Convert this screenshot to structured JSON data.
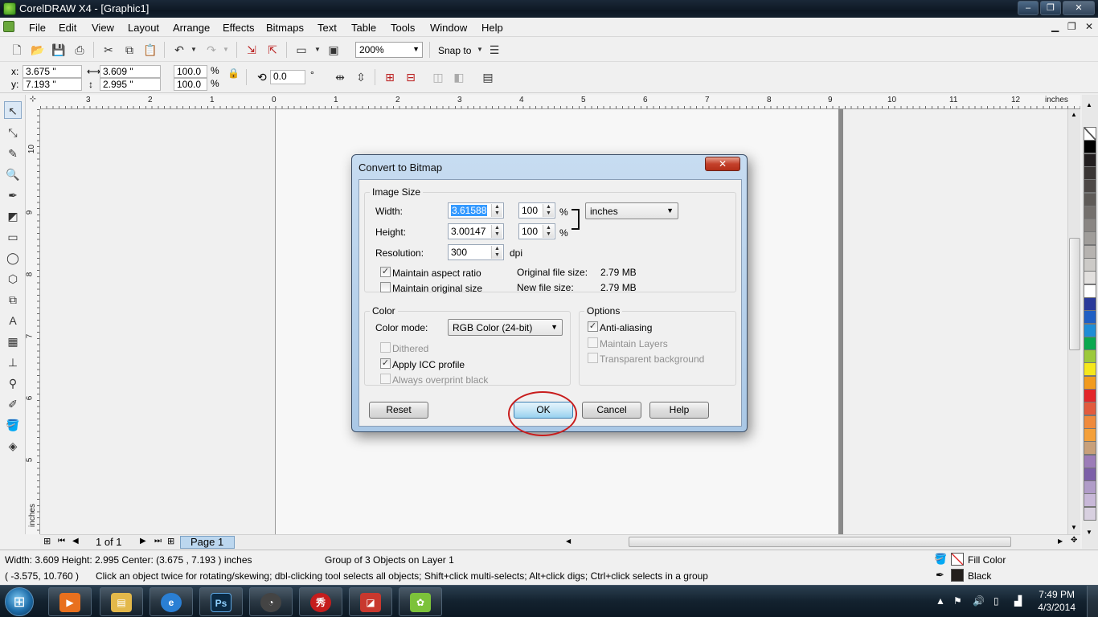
{
  "window": {
    "title": "CorelDRAW X4 - [Graphic1]",
    "minimize": "‒",
    "maximize": "❐",
    "close": "✕"
  },
  "menu": [
    "File",
    "Edit",
    "View",
    "Layout",
    "Arrange",
    "Effects",
    "Bitmaps",
    "Text",
    "Table",
    "Tools",
    "Window",
    "Help"
  ],
  "toolbar": {
    "zoom": "200%",
    "snap_to": "Snap to"
  },
  "property_bar": {
    "x_label": "x:",
    "x": "3.675 \"",
    "y_label": "y:",
    "y": "7.193 \"",
    "width": "3.609 \"",
    "height": "2.995 \"",
    "scale_x": "100.0",
    "scale_y": "100.0",
    "percent": "%",
    "rotation": "0.0",
    "degree": "°"
  },
  "ruler": {
    "units": "inches",
    "h_labels": [
      "3",
      "2",
      "1",
      "0",
      "1",
      "2",
      "3",
      "4",
      "5",
      "6",
      "7",
      "8",
      "9",
      "10",
      "11",
      "12"
    ],
    "v_labels": [
      "10",
      "9",
      "8",
      "7",
      "6",
      "5"
    ],
    "v_units": "inches"
  },
  "page_nav": {
    "position": "1 of 1",
    "tab": "Page 1"
  },
  "palette_colors": [
    "#ffffff",
    "#000000",
    "#231f20",
    "#3a3635",
    "#4d4846",
    "#5f5b58",
    "#74706d",
    "#8a8683",
    "#a09d9a",
    "#b6b3b0",
    "#cccac7",
    "#e2e0de",
    "#ffffff",
    "#2a3a9a",
    "#1f5fc4",
    "#1e8dd6",
    "#0aa84f",
    "#9cc93b",
    "#f5e71c",
    "#f29b1e",
    "#e3262a",
    "#e25a3d",
    "#ef8a3c",
    "#f4a03a",
    "#c8a07a",
    "#9c7cb8",
    "#7c5fa8",
    "#b09cc8",
    "#c8b8d8",
    "#d8d0e0"
  ],
  "status": {
    "dimensions": "Width: 3.609  Height: 2.995  Center: (3.675 , 7.193 )  inches",
    "object_info": "Group of 3 Objects on Layer 1",
    "cursor": "( -3.575, 10.760 )",
    "hint": "Click an object twice for rotating/skewing; dbl-clicking tool selects all objects; Shift+click multi-selects; Alt+click digs; Ctrl+click selects in a group",
    "fill_label": "Fill Color",
    "outline_label": "Black"
  },
  "taskbar": {
    "time": "7:49 PM",
    "date": "4/3/2014",
    "tasks": [
      "media-player",
      "explorer",
      "internet-explorer",
      "photoshop",
      "app-5",
      "app-6",
      "app-7",
      "coreldraw"
    ]
  },
  "dialog": {
    "title": "Convert to Bitmap",
    "close": "✕",
    "image_size": {
      "legend": "Image Size",
      "width_label": "Width:",
      "width": "3.61588",
      "width_pct": "100",
      "height_label": "Height:",
      "height": "3.00147",
      "height_pct": "100",
      "pct": "%",
      "units": "inches",
      "resolution_label": "Resolution:",
      "resolution": "300",
      "dpi": "dpi",
      "maintain_aspect": "Maintain aspect ratio",
      "maintain_original": "Maintain original size",
      "original_size_label": "Original file size:",
      "original_size": "2.79 MB",
      "new_size_label": "New file size:",
      "new_size": "2.79 MB"
    },
    "color": {
      "legend": "Color",
      "mode_label": "Color mode:",
      "mode": "RGB Color (24-bit)",
      "dithered": "Dithered",
      "apply_icc": "Apply ICC profile",
      "overprint": "Always overprint black"
    },
    "options": {
      "legend": "Options",
      "anti_aliasing": "Anti-aliasing",
      "maintain_layers": "Maintain Layers",
      "transparent_bg": "Transparent background"
    },
    "buttons": {
      "reset": "Reset",
      "ok": "OK",
      "cancel": "Cancel",
      "help": "Help"
    },
    "check_mark": "✓"
  }
}
